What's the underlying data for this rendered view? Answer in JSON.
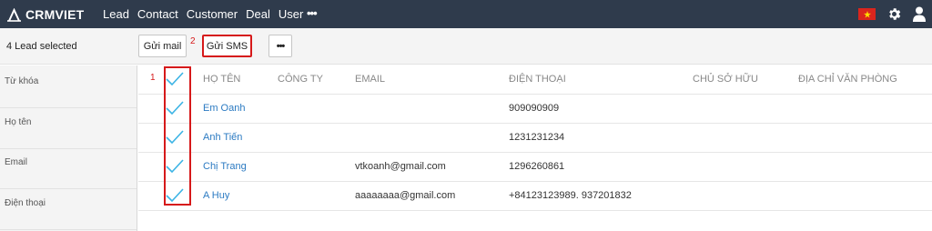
{
  "brand": {
    "name": "CRMVIET"
  },
  "nav": {
    "items": [
      "Lead",
      "Contact",
      "Customer",
      "Deal",
      "User"
    ],
    "more": "•••"
  },
  "toolbar": {
    "selected_text": "4 Lead selected",
    "mail_label": "Gửi mail",
    "sms_label": "Gửi SMS",
    "more_label": "•••"
  },
  "annotations": {
    "marker_1": "1",
    "marker_2": "2"
  },
  "filters": [
    "Từ khóa",
    "Họ tên",
    "Email",
    "Điện thoại"
  ],
  "table": {
    "headers": {
      "name": "HỌ TÊN",
      "company": "CÔNG TY",
      "email": "EMAIL",
      "phone": "ĐIỆN THOẠI",
      "owner": "CHỦ SỞ HỮU",
      "address": "ĐỊA CHỈ VĂN PHÒNG"
    },
    "rows": [
      {
        "name": "Em Oanh",
        "company": "",
        "email": "",
        "phone": "909090909",
        "owner": "",
        "address": ""
      },
      {
        "name": "Anh Tiến",
        "company": "",
        "email": "",
        "phone": "1231231234",
        "owner": "",
        "address": ""
      },
      {
        "name": "Chị Trang",
        "company": "",
        "email": "vtkoanh@gmail.com",
        "phone": "1296260861",
        "owner": "",
        "address": ""
      },
      {
        "name": "A Huy",
        "company": "",
        "email": "aaaaaaaa@gmail.com",
        "phone": "+84123123989. 937201832",
        "owner": "",
        "address": ""
      }
    ]
  },
  "colors": {
    "topbar": "#2f3b4c",
    "accent_red": "#d6191a",
    "link_blue": "#2b7ac2",
    "check_cyan": "#3bb4e5"
  },
  "icons": [
    "crm-logo-icon",
    "vietnam-flag-icon",
    "gear-icon",
    "user-icon",
    "checkmark-icon"
  ]
}
